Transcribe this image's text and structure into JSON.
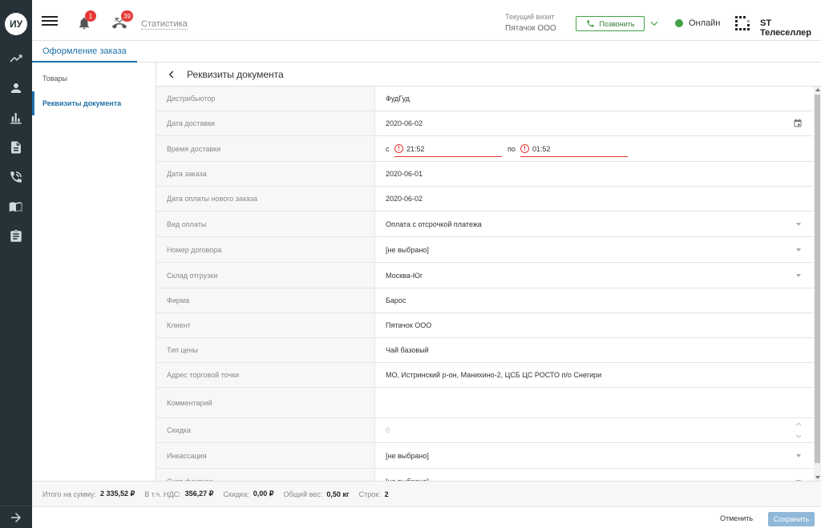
{
  "rail": {
    "avatar_initials": "ИУ",
    "icons": [
      "trend-icon",
      "user-icon",
      "bar-chart-icon",
      "document-icon",
      "phone-call-icon",
      "book-icon",
      "clipboard-icon"
    ],
    "bottom_icon": "arrow-right-icon"
  },
  "topbar": {
    "notifications_count": "1",
    "missed_calls_count": "39",
    "stats_link": "Статистика",
    "visit_label": "Текущий визит",
    "visit_value": "Пятачок ООО",
    "call_button": "Позвонить",
    "status": "Онлайн",
    "company": "ST Телеселлер",
    "colors": {
      "accent": "#1e6fa8",
      "online": "#43a047",
      "badge": "#e53935"
    }
  },
  "tab": {
    "label": "Оформление заказа"
  },
  "sidebar": {
    "items": [
      {
        "label": "Товары"
      },
      {
        "label": "Реквизиты документа"
      }
    ]
  },
  "doc": {
    "title": "Реквизиты документа",
    "fields": {
      "distributor": {
        "label": "Дистрибьютор",
        "value": "ФудГуд"
      },
      "delivery_date": {
        "label": "Дата доставки",
        "value": "2020-06-02"
      },
      "delivery_time": {
        "label": "Время доставки",
        "from_label": "с",
        "from_value": "21:52",
        "to_label": "по",
        "to_value": "01:52"
      },
      "order_date": {
        "label": "Дата заказа",
        "value": "2020-06-01"
      },
      "payment_date": {
        "label": "Дата оплаты нового заказа",
        "value": "2020-06-02"
      },
      "payment_type": {
        "label": "Вид оплаты",
        "value": "Оплата с отсрочкой платежа"
      },
      "contract_number": {
        "label": "Номер договора",
        "value": "[не выбрано]"
      },
      "warehouse": {
        "label": "Склад отгрузки",
        "value": "Москва-Юг"
      },
      "firm": {
        "label": "Фирма",
        "value": "Барос"
      },
      "client": {
        "label": "Клиент",
        "value": "Пятачок ООО"
      },
      "price_type": {
        "label": "Тип цены",
        "value": "Чай базовый"
      },
      "address": {
        "label": "Адрес торговой точки",
        "value": "МО, Истринский р-он, Манихино-2, ЦСБ ЦС РОСТО п/о Снегири"
      },
      "comment": {
        "label": "Комментарий",
        "value": ""
      },
      "discount": {
        "label": "Скидка",
        "value": "0"
      },
      "collection": {
        "label": "Инкассация",
        "value": "[не выбрано]"
      },
      "invoice": {
        "label": "Счет-фактура",
        "value": "[не выбрано]"
      }
    }
  },
  "totals": {
    "sum_label": "Итого на сумму:",
    "sum_value": "2 335,52 ₽",
    "vat_label": "В т.ч. НДС:",
    "vat_value": "356,27 ₽",
    "discount_label": "Скидка:",
    "discount_value": "0,00 ₽",
    "weight_label": "Общий вес:",
    "weight_value": "0,50 кг",
    "rows_label": "Строк:",
    "rows_value": "2"
  },
  "footer": {
    "cancel": "Отменить",
    "save": "Сохранить"
  }
}
